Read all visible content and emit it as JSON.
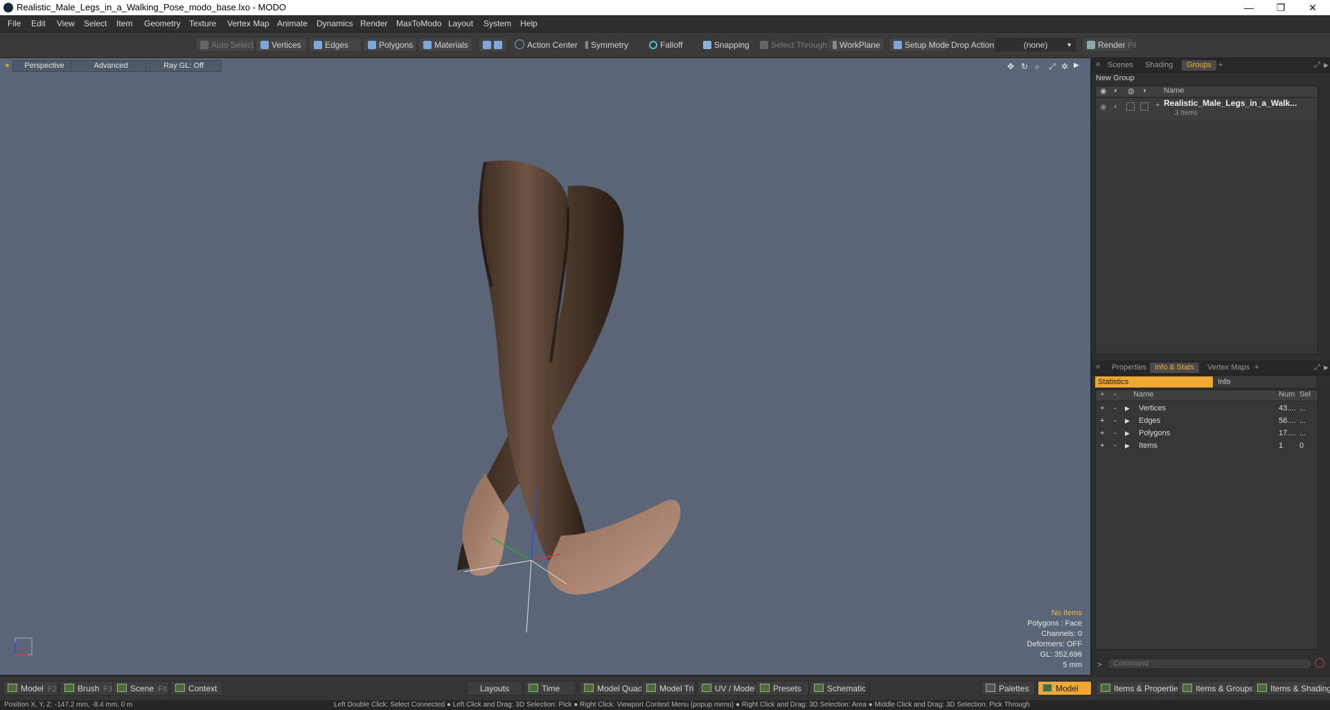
{
  "window": {
    "title": "Realistic_Male_Legs_in_a_Walking_Pose_modo_base.lxo - MODO",
    "minimize": "—",
    "restore": "❐",
    "close": "✕"
  },
  "menu": [
    "File",
    "Edit",
    "View",
    "Select",
    "Item",
    "Geometry",
    "Texture",
    "Vertex Map",
    "Animate",
    "Dynamics",
    "Render",
    "MaxToModo",
    "Layout",
    "System",
    "Help"
  ],
  "toolbar": {
    "auto_select": "Auto Select",
    "vertices": "Vertices",
    "edges": "Edges",
    "polygons": "Polygons",
    "materials": "Materials",
    "action_center": "Action Center",
    "symmetry": "Symmetry",
    "falloff": "Falloff",
    "snapping": "Snapping",
    "select_through": "Select Through",
    "workplane": "WorkPlane",
    "setup_mode": "Setup Mode",
    "drop_action_label": "Drop Action",
    "drop_action_value": "(none)",
    "render": "Render",
    "render_key": "F9"
  },
  "viewport": {
    "view_mode": "Perspective",
    "shading": "Advanced",
    "ray_gl": "Ray GL: Off",
    "info": {
      "items": "No Items",
      "polygons": "Polygons : Face",
      "channels": "Channels: 0",
      "deformers": "Deformers: OFF",
      "gl": "GL: 352,696",
      "scale": "5 mm"
    }
  },
  "groups_panel": {
    "tabs": [
      "Scenes",
      "Shading",
      "Groups"
    ],
    "active_tab": "Groups",
    "new_group": "New Group",
    "column_name": "Name",
    "item_name": "Realistic_Male_Legs_in_a_Walk...",
    "item_count": "3 Items"
  },
  "stats_panel": {
    "tabs": [
      "Properties",
      "Info & Stats",
      "Vertex Maps"
    ],
    "active_tab": "Info & Stats",
    "subtabs": [
      "Statistics",
      "Info"
    ],
    "columns": [
      "Name",
      "Num",
      "Sel"
    ],
    "rows": [
      {
        "name": "Vertices",
        "num": "43....",
        "sel": "..."
      },
      {
        "name": "Edges",
        "num": "56....",
        "sel": "..."
      },
      {
        "name": "Polygons",
        "num": "17....",
        "sel": "..."
      },
      {
        "name": "Items",
        "num": "1",
        "sel": "0"
      }
    ],
    "command_placeholder": "Command"
  },
  "bottombar": {
    "model": "Model",
    "model_key": "F2",
    "brush": "Brush",
    "brush_key": "F3",
    "scene": "Scene",
    "scene_key": "F4",
    "context": "Context",
    "layouts": "Layouts",
    "time": "Time",
    "model_quad": "Model Quad",
    "model_tri": "Model Tri",
    "uv_model": "UV / Model",
    "presets": "Presets",
    "schematic": "Schematic",
    "palettes": "Palettes",
    "model_active": "Model",
    "items_properties": "Items & Properties",
    "items_groups": "Items & Groups",
    "items_shading": "Items & Shading"
  },
  "status": {
    "position": "Position X, Y, Z:  -147.2 mm, -8.4 mm, 0 m",
    "hint": "Left Double Click: Select Connected ● Left Click and Drag: 3D Selection: Pick ● Right Click: Viewport Context Menu (popup menu) ● Right Click and Drag: 3D Selection: Area ● Middle Click and Drag: 3D Selection: Pick Through"
  },
  "colors": {
    "accent": "#f0a833",
    "viewport_bg": "#5a6677",
    "panel_bg": "#2e2e2e"
  }
}
